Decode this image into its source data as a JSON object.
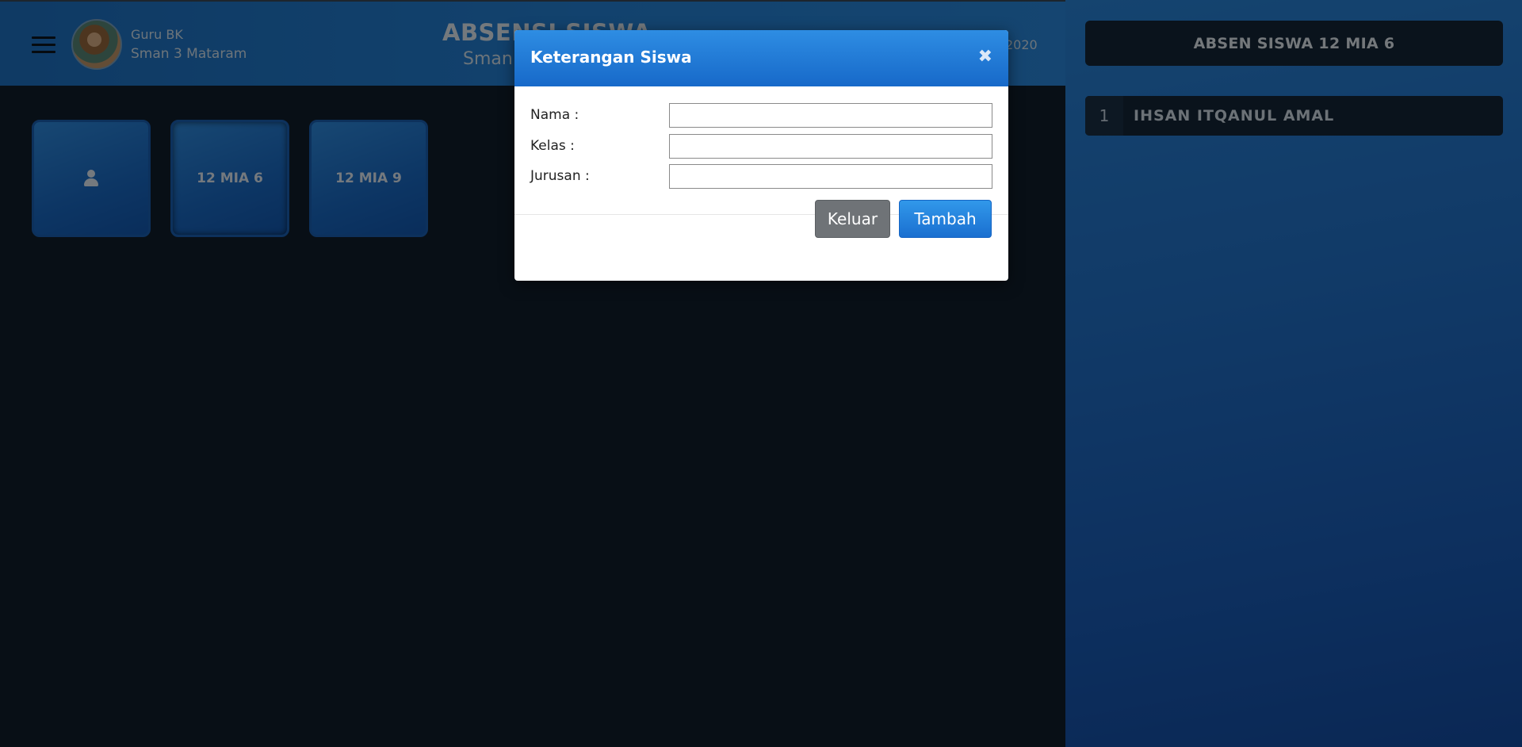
{
  "header": {
    "user_name": "Guru BK",
    "user_school": "Sman 3 Mataram",
    "title": "ABSENSI SISWA",
    "subtitle_partial": "Sman",
    "year_partial": "2020"
  },
  "classes": [
    {
      "label": ""
    },
    {
      "label": "12 MIA 6"
    },
    {
      "label": "12 MIA 9"
    }
  ],
  "panel": {
    "header": "ABSEN SISWA 12 MIA 6",
    "students": [
      {
        "no": "1",
        "name": "IHSAN ITQANUL AMAL"
      }
    ]
  },
  "modal": {
    "title": "Keterangan Siswa",
    "close_icon": "close-icon",
    "fields": [
      {
        "label": "Nama :",
        "value": "",
        "placeholder": ""
      },
      {
        "label": "Kelas :",
        "value": "",
        "placeholder": ""
      },
      {
        "label": "Jurusan :",
        "value": "",
        "placeholder": ""
      }
    ],
    "cancel_label": "Keluar",
    "submit_label": "Tambah"
  },
  "colors": {
    "accent": "#2585dc",
    "dark_panel": "#142638",
    "cancel_button": "#6f7377",
    "submit_button": "#1a6fd0"
  }
}
